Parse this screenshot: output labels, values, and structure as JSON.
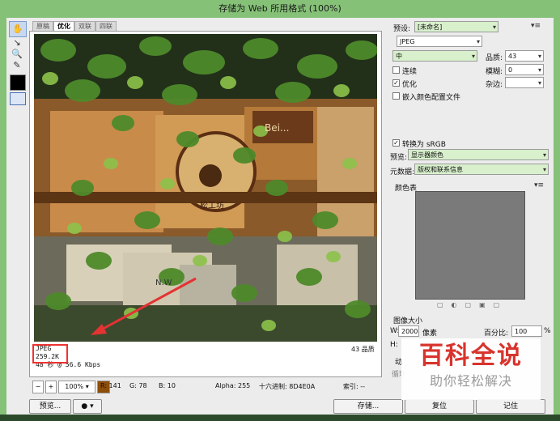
{
  "window": {
    "title": "存储为 Web 所用格式 (100%)"
  },
  "tabs": [
    {
      "label": "原稿"
    },
    {
      "label": "优化"
    },
    {
      "label": "双联"
    },
    {
      "label": "四联"
    }
  ],
  "image_info": {
    "format": "JPEG",
    "size": "259.2K",
    "time": "48 秒 @ 56.6 Kbps",
    "quality": "43 品质"
  },
  "statusbar": {
    "zoom": "100%",
    "r": "R: 141",
    "g": "G: 78",
    "b": "B: 10",
    "alpha": "Alpha: 255",
    "hex": "十六进制: 8D4E0A",
    "index": "索引: --"
  },
  "buttons": {
    "preview": "预览...",
    "save": "存储...",
    "reset": "复位",
    "remember": "记住"
  },
  "settings": {
    "preset_label": "预设:",
    "preset_value": "[未命名]",
    "format_value": "JPEG",
    "quality_level": "中",
    "quality_label": "品质:",
    "quality_value": "43",
    "progressive_label": "连续",
    "blur_label": "模糊:",
    "blur_value": "0",
    "optimized_label": "优化",
    "matte_label": "杂边:",
    "embed_profile_label": "嵌入颜色配置文件",
    "convert_srgb_label": "转换为 sRGB",
    "preview_label": "预览:",
    "preview_value": "显示器颜色",
    "metadata_label": "元数据:",
    "metadata_value": "版权和联系信息",
    "color_table_label": "颜色表",
    "image_size_label": "图像大小",
    "width_label": "W:",
    "width_value": "2000",
    "width_unit": "像素",
    "height_label": "H:",
    "percent_label": "百分比:",
    "percent_value": "100",
    "percent_unit": "%",
    "anim_label": "动",
    "loop_label": "循环"
  },
  "watermark": {
    "line1": "百科全说",
    "line2": "助你轻松解决"
  },
  "photo": {
    "sign_text": "Bei...",
    "shelf_text": "N.W",
    "shop_text": "松工坊"
  },
  "colors": {
    "accent_green": "#86c178",
    "highlight_field": "#d8f0cc",
    "annotation_red": "#e33333"
  }
}
